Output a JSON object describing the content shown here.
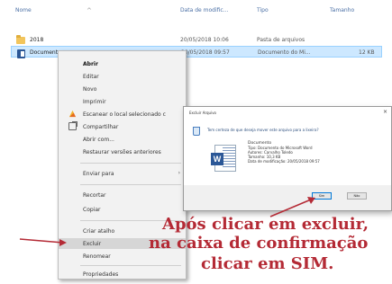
{
  "columns": {
    "name": "Nome",
    "date": "Data de modific...",
    "type": "Tipo",
    "size": "Tamanho"
  },
  "files": [
    {
      "name": "2018",
      "date": "20/05/2018 10:06",
      "type": "Pasta de arquivos",
      "size": ""
    },
    {
      "name": "Document",
      "date": "20/05/2018 09:57",
      "type": "Documento do Mi...",
      "size": "12 KB"
    }
  ],
  "context_menu": {
    "items": [
      {
        "label": "Abrir",
        "bold": true
      },
      {
        "label": "Editar"
      },
      {
        "label": "Novo"
      },
      {
        "label": "Imprimir"
      },
      {
        "label": "Escanear o local selecionado c",
        "icon": "scan-icon"
      },
      {
        "label": "Compartilhar",
        "icon": "share-icon"
      },
      {
        "label": "Abrir com..."
      },
      {
        "label": "Restaurar versões anteriores"
      },
      {
        "label": "Enviar para",
        "submenu": true
      },
      {
        "label": "Recortar"
      },
      {
        "label": "Copiar"
      },
      {
        "label": "Criar atalho"
      },
      {
        "label": "Excluir",
        "highlight": true
      },
      {
        "label": "Renomear"
      },
      {
        "label": "Propriedades"
      }
    ]
  },
  "dialog": {
    "title": "Excluir Arquivo",
    "question": "Tem certeza de que deseja mover este arquivo para a lixeira?",
    "file_name": "Documento",
    "file_type": "Tipo: Documento do Microsoft Word",
    "file_author": "Autores: Carvalho Toledo",
    "file_size": "Tamanho: 10,3 KB",
    "file_modified": "Data de modificação: 20/05/2018 09:57",
    "yes_label": "Sim",
    "no_label": "Não",
    "close_symbol": "×"
  },
  "annotation": {
    "line1": "Após clicar em excluir,",
    "line2": "na caixa de confirmação",
    "line3": "clicar em SIM.",
    "color": "#b42a35"
  }
}
